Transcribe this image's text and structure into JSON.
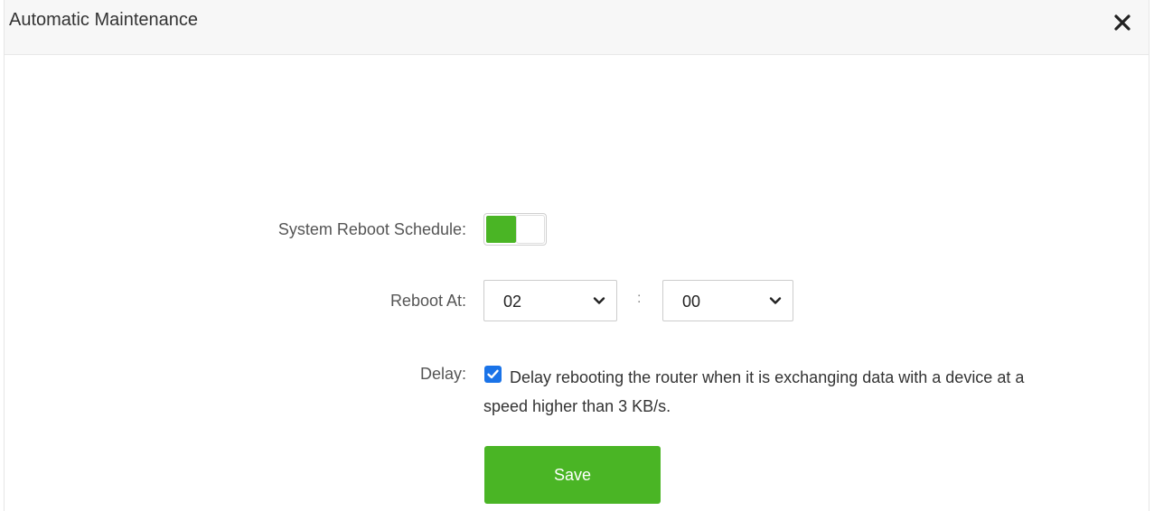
{
  "dialog": {
    "title": "Automatic Maintenance",
    "close_icon": "close-icon"
  },
  "form": {
    "reboot_schedule": {
      "label": "System Reboot Schedule:",
      "enabled": true
    },
    "reboot_at": {
      "label": "Reboot At:",
      "hour": "02",
      "separator": ":",
      "minute": "00",
      "chevron_icon": "chevron-down-icon"
    },
    "delay": {
      "label": "Delay:",
      "checked": true,
      "text": "Delay rebooting the router when it is exchanging data with a device at a speed higher than 3 KB/s."
    },
    "save_label": "Save"
  },
  "colors": {
    "accent_green": "#4ab525",
    "checkbox_blue": "#1a73e8",
    "header_bg": "#f7f7f7"
  }
}
